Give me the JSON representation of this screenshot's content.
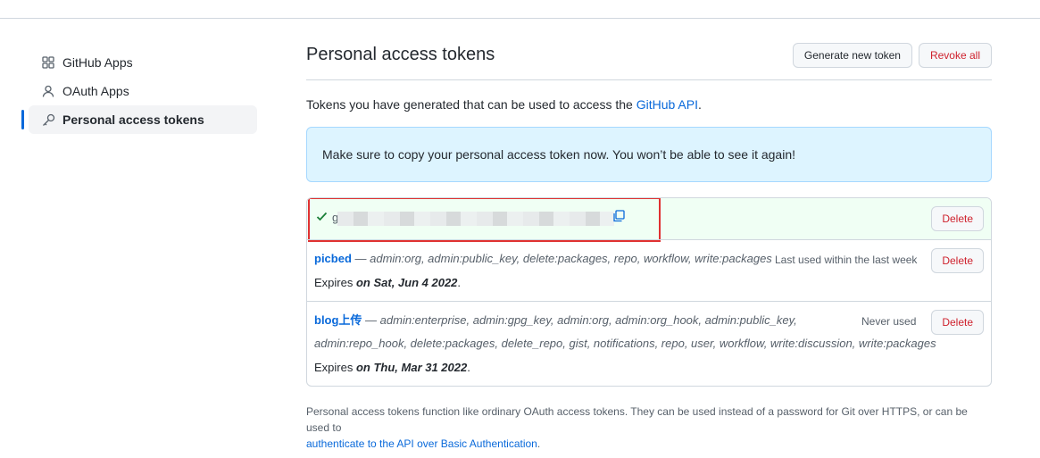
{
  "sidebar": {
    "items": [
      {
        "label": "GitHub Apps",
        "icon": "apps-icon"
      },
      {
        "label": "OAuth Apps",
        "icon": "person-icon"
      },
      {
        "label": "Personal access tokens",
        "icon": "key-icon"
      }
    ]
  },
  "header": {
    "title": "Personal access tokens",
    "generate_label": "Generate new token",
    "revoke_label": "Revoke all"
  },
  "intro": {
    "text": "Tokens you have generated that can be used to access the ",
    "link": "GitHub API",
    "suffix": "."
  },
  "flash": {
    "text": "Make sure to copy your personal access token now. You won’t be able to see it again!"
  },
  "tokens": {
    "new_token": {
      "prefix": "g",
      "delete_label": "Delete"
    },
    "items": [
      {
        "name": "picbed",
        "scopes": " — admin:org, admin:public_key, delete:packages, repo, workflow, write:packages",
        "last_used": "Last used within the last week",
        "expires_label": "Expires ",
        "expires_date": "on Sat, Jun 4 2022",
        "delete_label": "Delete"
      },
      {
        "name": "blog上传",
        "scopes_line1": " — admin:enterprise, admin:gpg_key, admin:org, admin:org_hook, admin:public_key,",
        "scopes_line2": "admin:repo_hook, delete:packages, delete_repo, gist, notifications, repo, user, workflow, write:discussion, write:packages",
        "last_used": "Never used",
        "expires_label": "Expires ",
        "expires_date": "on Thu, Mar 31 2022",
        "delete_label": "Delete"
      }
    ]
  },
  "footer": {
    "text": "Personal access tokens function like ordinary OAuth access tokens. They can be used instead of a password for Git over HTTPS, or can be used to",
    "link": "authenticate to the API over Basic Authentication",
    "suffix": "."
  },
  "colors": {
    "accent": "#0969da",
    "danger": "#cf222e",
    "success": "#1a7f37",
    "highlight": "#e03131"
  }
}
